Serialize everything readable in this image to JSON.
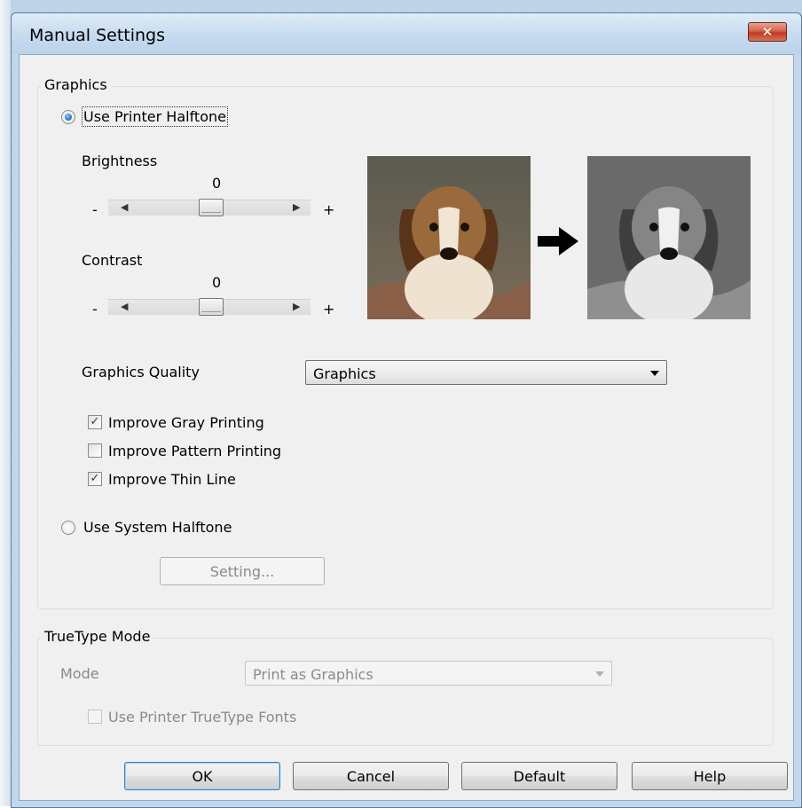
{
  "window": {
    "title": "Manual Settings",
    "close_glyph": "✕"
  },
  "graphics": {
    "caption": "Graphics",
    "use_printer_halftone": {
      "label": "Use Printer Halftone",
      "selected": true
    },
    "brightness": {
      "label": "Brightness",
      "value": "0",
      "minus": "-",
      "plus": "+"
    },
    "contrast": {
      "label": "Contrast",
      "value": "0",
      "minus": "-",
      "plus": "+"
    },
    "graphics_quality": {
      "label": "Graphics Quality",
      "value": "Graphics"
    },
    "improve_gray_printing": {
      "label": "Improve Gray Printing",
      "checked": true
    },
    "improve_pattern_printing": {
      "label": "Improve Pattern Printing",
      "checked": false
    },
    "improve_thin_line": {
      "label": "Improve Thin Line",
      "checked": true
    },
    "use_system_halftone": {
      "label": "Use System Halftone",
      "selected": false
    },
    "setting_button": "Setting...",
    "check_glyph": "✓"
  },
  "truetype": {
    "caption": "TrueType Mode",
    "mode_label": "Mode",
    "mode_value": "Print as Graphics",
    "use_printer_fonts": {
      "label": "Use Printer TrueType Fonts",
      "checked": false
    }
  },
  "buttons": {
    "ok": "OK",
    "cancel": "Cancel",
    "default": "Default",
    "help": "Help"
  },
  "icons": {
    "slider_left": "◀",
    "slider_right": "▶"
  }
}
